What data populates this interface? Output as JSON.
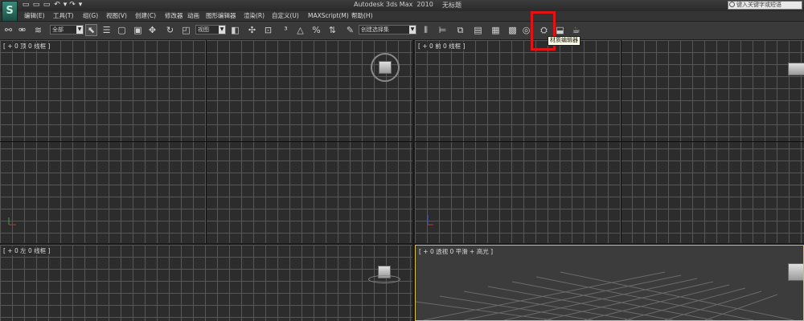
{
  "app": {
    "title": "Autodesk 3ds Max  2010",
    "filename": "无标题",
    "logo_glyph": "S",
    "search_placeholder": "键入关键字或短语"
  },
  "quick_access": [
    {
      "name": "new-file-icon",
      "glyph": "▭"
    },
    {
      "name": "open-file-icon",
      "glyph": "▭"
    },
    {
      "name": "save-file-icon",
      "glyph": "▭"
    },
    {
      "name": "undo-icon",
      "glyph": "↶"
    },
    {
      "name": "undo-dropdown-icon",
      "glyph": "▾"
    },
    {
      "name": "redo-icon",
      "glyph": "↷"
    },
    {
      "name": "redo-dropdown-icon",
      "glyph": "▾"
    }
  ],
  "menu": {
    "edit": "编辑(E)",
    "tools": "工具(T)",
    "group": "组(G)",
    "views": "视图(V)",
    "create": "创建(C)",
    "modifiers": "修改器",
    "animation": "动画",
    "graph_editors": "图形编辑器",
    "rendering": "渲染(R)",
    "customize": "自定义(U)",
    "maxscript": "MAXScript(M)",
    "help": "帮助(H)"
  },
  "toolbar": {
    "filter_select": "全部",
    "ref_coord_select": "视图",
    "named_selection_select": "创建选择集",
    "tooltip": "材质编辑器"
  },
  "viewports": {
    "top_label": "[ + 0 顶 0 线框 ]",
    "front_label": "[ + 0 前 0 线框 ]",
    "left_label": "[ + 0 左 0 线框 ]",
    "perspective_label": "[ + 0 透视 0 平滑 + 高光 ]"
  }
}
